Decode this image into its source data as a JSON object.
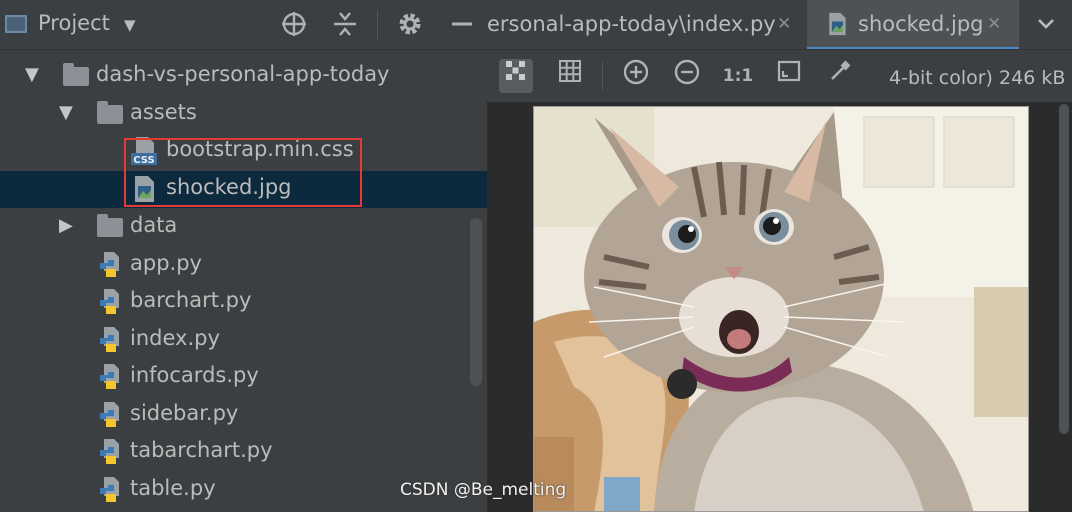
{
  "project_panel": {
    "title": "Project",
    "dropdown_icon": "caret-down",
    "toolbar_icons": [
      "locate-crosshair-icon",
      "collapse-all-icon",
      "gear-icon",
      "minimize-icon"
    ]
  },
  "tree": {
    "root": {
      "label": "dash-vs-personal-app-today",
      "expanded": true
    },
    "assets": {
      "label": "assets",
      "expanded": true
    },
    "assets_files": [
      {
        "label": "bootstrap.min.css",
        "type": "css"
      },
      {
        "label": "shocked.jpg",
        "type": "image",
        "selected": true
      }
    ],
    "data_folder": {
      "label": "data",
      "expanded": false
    },
    "py_files": [
      "app.py",
      "barchart.py",
      "index.py",
      "infocards.py",
      "sidebar.py",
      "tabarchart.py",
      "table.py"
    ]
  },
  "tabs": [
    {
      "label": "ersonal-app-today\\index.py",
      "close": "✕",
      "active": false
    },
    {
      "label": "shocked.jpg",
      "close": "✕",
      "active": true
    }
  ],
  "tabs_menu_icon": "chevron-down",
  "image_toolbar": {
    "buttons": [
      "chessboard-icon",
      "grid-icon",
      "zoom-in-icon",
      "zoom-out-icon",
      "actual-size-icon",
      "fit-icon",
      "color-picker-icon"
    ],
    "one_to_one": "1:1",
    "info": "4-bit color) 246 kB"
  },
  "watermark": "CSDN @Be_melting",
  "colors": {
    "selection": "#0d293e",
    "highlight_box": "#e53935",
    "accent": "#4a88c7",
    "python_blue": "#3d7ab8",
    "python_yellow": "#f2c62c"
  }
}
